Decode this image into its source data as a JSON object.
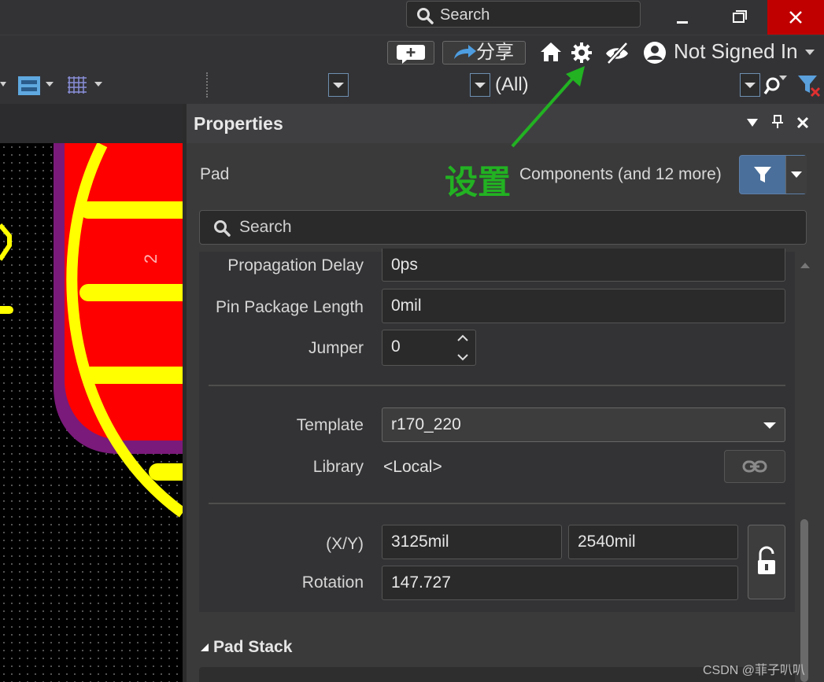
{
  "titlebar": {
    "search_placeholder": "Search"
  },
  "userbar": {
    "share_label": "分享",
    "user_label": "Not Signed In"
  },
  "toolbar": {
    "filter_value": "(All)"
  },
  "canvas": {
    "pad_number": "2"
  },
  "panel": {
    "title": "Properties",
    "object_type": "Pad",
    "annotation": "设置",
    "filter_summary": "Components (and 12 more)",
    "search_placeholder": "Search",
    "fields": {
      "propagation_delay": {
        "label": "Propagation Delay",
        "value": "0ps"
      },
      "pin_package_length": {
        "label": "Pin Package Length",
        "value": "0mil"
      },
      "jumper": {
        "label": "Jumper",
        "value": "0"
      },
      "template": {
        "label": "Template",
        "value": "r170_220"
      },
      "library": {
        "label": "Library",
        "value": "<Local>"
      },
      "xy": {
        "label": "(X/Y)",
        "x": "3125mil",
        "y": "2540mil"
      },
      "rotation": {
        "label": "Rotation",
        "value": "147.727"
      }
    },
    "section_pad_stack": "Pad Stack"
  },
  "watermark": "CSDN @菲子叭叭",
  "colors": {
    "annotation_green": "#22b222",
    "close_red": "#c00000",
    "pad_red": "#ff0000",
    "silk_yellow": "#ffff00",
    "mask_purple": "#7a1a7a",
    "filter_blue": "#4a6f9a"
  }
}
